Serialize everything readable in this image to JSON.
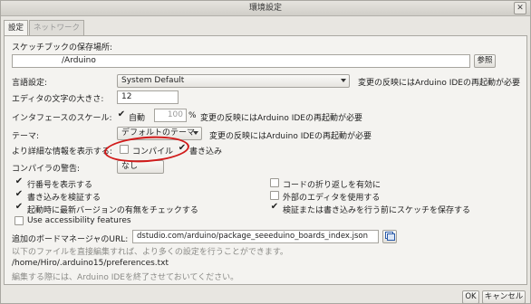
{
  "window": {
    "title": "環境設定",
    "close_symbol": "✕"
  },
  "tabs": [
    {
      "label": "設定"
    },
    {
      "label": "ネットワーク"
    }
  ],
  "sketchbook": {
    "label": "スケッチブックの保存場所:",
    "path": "/Arduino",
    "browse_label": "参照"
  },
  "language": {
    "label": "言語設定:",
    "value": "System Default",
    "note": "変更の反映にはArduino IDEの再起動が必要"
  },
  "editor_font": {
    "label": "エディタの文字の大きさ:",
    "value": "12"
  },
  "interface_scale": {
    "label": "インタフェースのスケール:",
    "auto_label": "自動",
    "value": "100",
    "unit": "%",
    "note": "変更の反映にはArduino IDEの再起動が必要"
  },
  "theme": {
    "label": "テーマ:",
    "value": "デフォルトのテーマ",
    "note": "変更の反映にはArduino IDEの再起動が必要"
  },
  "verbose": {
    "label": "より詳細な情報を表示する:",
    "compile_label": "コンパイル",
    "upload_label": "書き込み"
  },
  "warnings": {
    "label": "コンパイラの警告:",
    "value": "なし"
  },
  "options_left": [
    {
      "label": "行番号を表示する",
      "checked": true
    },
    {
      "label": "書き込みを検証する",
      "checked": true
    },
    {
      "label": "起動時に最新バージョンの有無をチェックする",
      "checked": true
    },
    {
      "label": "Use accessibility features",
      "checked": false
    }
  ],
  "options_right": [
    {
      "label": "コードの折り返しを有効に",
      "checked": false
    },
    {
      "label": "外部のエディタを使用する",
      "checked": false
    },
    {
      "label": "検証または書き込みを行う前にスケッチを保存する",
      "checked": true
    }
  ],
  "board_manager": {
    "label": "追加のボードマネージャのURL:",
    "value": "dstudio.com/arduino/package_seeeduino_boards_index.json"
  },
  "footer": {
    "info1": "以下のファイルを直接編集すれば、より多くの設定を行うことができます。",
    "prefs_path": "/home/Hiro/.arduino15/preferences.txt",
    "info2": "編集する際には、Arduino IDEを終了させておいてください。"
  },
  "buttons": {
    "ok": "OK",
    "cancel": "キャンセル"
  },
  "colors": {
    "annotation": "#d11a1a"
  }
}
